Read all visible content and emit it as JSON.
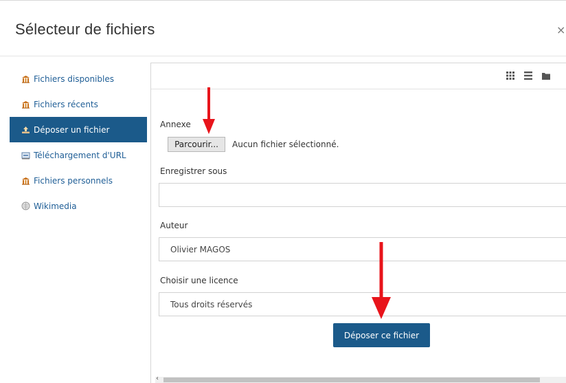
{
  "dialog": {
    "title": "Sélecteur de fichiers",
    "close_symbol": "×"
  },
  "sidebar": {
    "items": [
      {
        "label": "Fichiers disponibles",
        "icon": "repository-icon",
        "active": false
      },
      {
        "label": "Fichiers récents",
        "icon": "repository-icon",
        "active": false
      },
      {
        "label": "Déposer un fichier",
        "icon": "upload-icon",
        "active": true
      },
      {
        "label": "Téléchargement d'URL",
        "icon": "url-download-icon",
        "active": false
      },
      {
        "label": "Fichiers personnels",
        "icon": "repository-icon",
        "active": false
      },
      {
        "label": "Wikimedia",
        "icon": "wikimedia-icon",
        "active": false
      }
    ]
  },
  "toolbar": {
    "views": [
      "grid-view-icon",
      "list-view-icon",
      "folder-view-icon"
    ]
  },
  "form": {
    "attachment_label": "Annexe",
    "browse_label": "Parcourir...",
    "no_file_text": "Aucun fichier sélectionné.",
    "save_as_label": "Enregistrer sous",
    "save_as_value": "",
    "author_label": "Auteur",
    "author_value": "Olivier MAGOS",
    "license_label": "Choisir une licence",
    "license_value": "Tous droits réservés",
    "submit_label": "Déposer ce fichier"
  },
  "colors": {
    "accent": "#1b5a8a",
    "link": "#1f5e96",
    "annotation_arrow": "#e8141b"
  }
}
